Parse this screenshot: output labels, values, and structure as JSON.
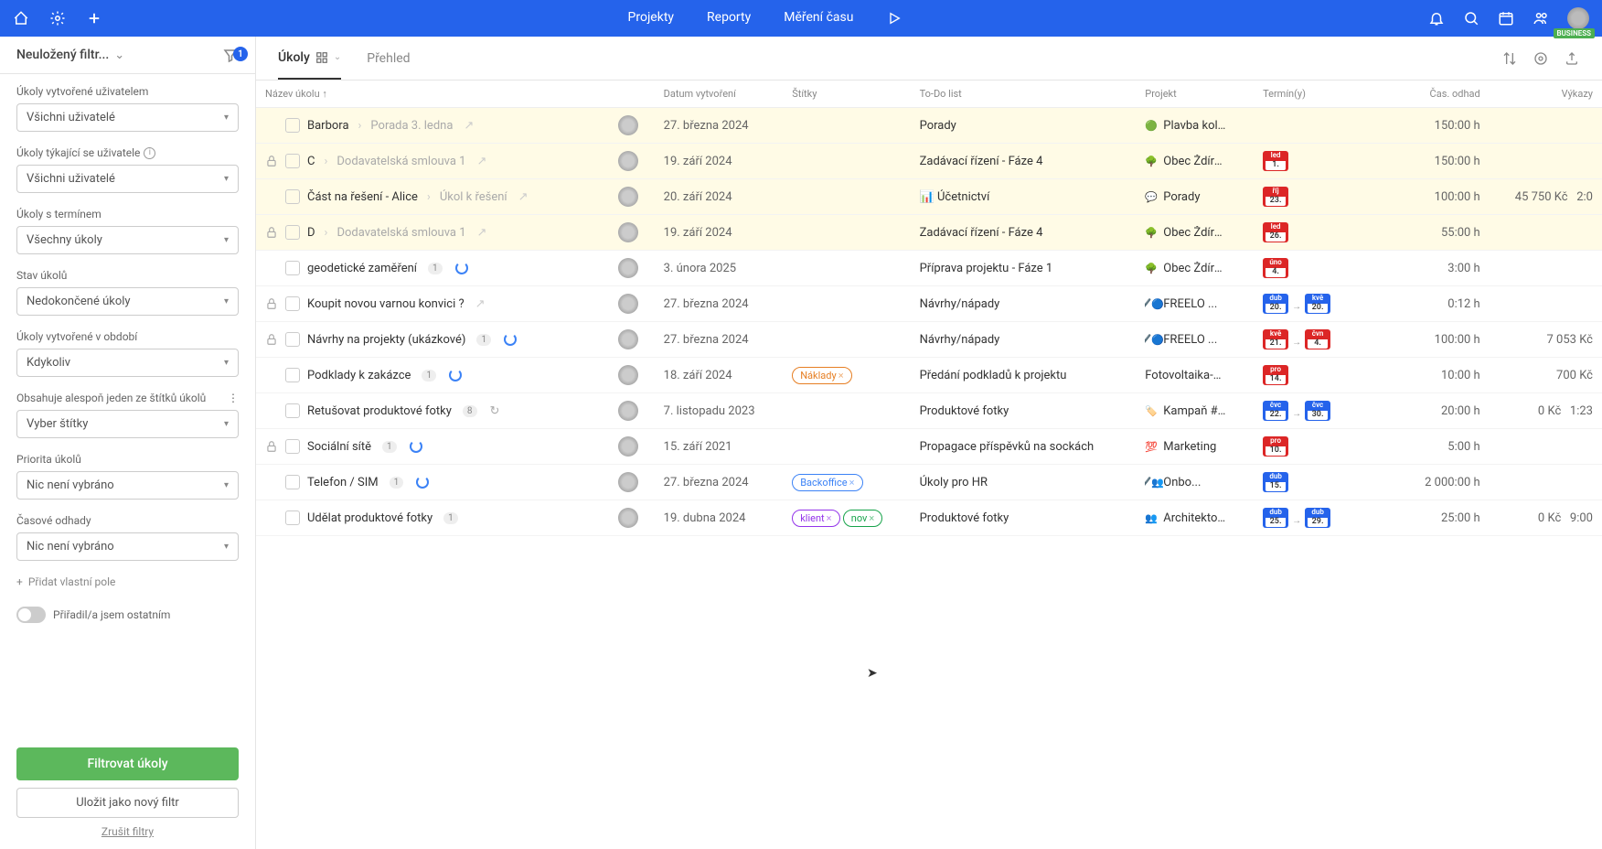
{
  "topbar": {
    "links": [
      "Projekty",
      "Reporty",
      "Měření času"
    ],
    "business": "BUSINESS"
  },
  "sidebar": {
    "filterTitle": "Neuložený filtr...",
    "badge": "1",
    "groups": [
      {
        "label": "Úkoly vytvořené uživatelem",
        "value": "Všichni uživatelé"
      },
      {
        "label": "Úkoly týkající se uživatele",
        "value": "Všichni uživatelé",
        "info": true
      },
      {
        "label": "Úkoly s termínem",
        "value": "Všechny úkoly"
      },
      {
        "label": "Stav úkolů",
        "value": "Nedokončené úkoly"
      },
      {
        "label": "Úkoly vytvořené v období",
        "value": "Kdykoliv"
      },
      {
        "label": "Obsahuje alespoň jeden ze štítků úkolů",
        "value": "Vyber štítky",
        "more": true
      },
      {
        "label": "Priorita úkolů",
        "value": "Nic není vybráno"
      },
      {
        "label": "Časové odhady",
        "value": "Nic není vybráno"
      }
    ],
    "addField": "Přidat vlastní pole",
    "toggleLabel": "Přiřadil/a jsem ostatním",
    "btnFilter": "Filtrovat úkoly",
    "btnSave": "Uložit jako nový filtr",
    "btnCancel": "Zrušit filtry"
  },
  "tabs": {
    "active": "Úkoly",
    "other": "Přehled"
  },
  "columns": [
    "Název úkolu ↑",
    "",
    "Datum vytvoření",
    "Štítky",
    "To-Do list",
    "Projekt",
    "Termín(y)",
    "Čas. odhad",
    "Výkazy"
  ],
  "rows": [
    {
      "hl": true,
      "lock": false,
      "name": "Barbora",
      "sub": "Porada 3. ledna",
      "ext": true,
      "date": "27. března 2024",
      "tags": [],
      "todo": "Porady",
      "projIcon": "🟢",
      "proj": "Plavba kole...",
      "term": [],
      "est": "150:00 h",
      "vyk": ""
    },
    {
      "hl": true,
      "lock": true,
      "name": "C",
      "sub": "Dodavatelská smlouva 1",
      "ext": true,
      "date": "19. září 2024",
      "tags": [],
      "todo": "Zadávací řízení - Fáze 4",
      "projIcon": "🌳",
      "proj": "Obec Ždíre...",
      "term": [
        {
          "c": "red",
          "m": "led",
          "d": "1."
        }
      ],
      "est": "150:00 h",
      "vyk": ""
    },
    {
      "hl": true,
      "lock": false,
      "name": "Část na řešení - Alice",
      "sub": "Úkol k řešení",
      "ext": true,
      "date": "20. září 2024",
      "tags": [],
      "todo": "📊 Účetnictví",
      "projIcon": "💬",
      "proj": "Porady",
      "term": [
        {
          "c": "red",
          "m": "říj",
          "d": "23."
        }
      ],
      "est": "100:00 h",
      "vyk": "45 750 Kč",
      "vyk2": "2:0"
    },
    {
      "hl": true,
      "lock": true,
      "name": "D",
      "sub": "Dodavatelská smlouva 1",
      "ext": true,
      "date": "19. září 2024",
      "tags": [],
      "todo": "Zadávací řízení - Fáze 4",
      "projIcon": "🌳",
      "proj": "Obec Ždíre...",
      "term": [
        {
          "c": "red",
          "m": "led",
          "d": "26."
        }
      ],
      "est": "55:00 h",
      "vyk": ""
    },
    {
      "hl": false,
      "lock": false,
      "name": "geodetické zaměření",
      "badge": "1",
      "spin": true,
      "date": "3. února 2025",
      "tags": [],
      "todo": "Příprava projektu - Fáze 1",
      "projIcon": "🌳",
      "proj": "Obec Ždíre...",
      "term": [
        {
          "c": "red",
          "m": "úno",
          "d": "4."
        }
      ],
      "est": "3:00 h",
      "vyk": ""
    },
    {
      "hl": false,
      "lock": true,
      "name": "Koupit novou varnou konvici ?",
      "ext": true,
      "date": "27. března 2024",
      "tags": [],
      "todo": "Návrhy/nápady",
      "projIcon": "✔️🔵",
      "proj": "FREELO ...",
      "term": [
        {
          "c": "blue",
          "m": "dub",
          "d": "20."
        },
        {
          "c": "blue",
          "m": "kvě",
          "d": "20."
        }
      ],
      "est": "0:12 h",
      "vyk": ""
    },
    {
      "hl": false,
      "lock": true,
      "name": "Návrhy na projekty (ukázkové)",
      "badge": "1",
      "spin": true,
      "date": "27. března 2024",
      "tags": [],
      "todo": "Návrhy/nápady",
      "projIcon": "✔️🔵",
      "proj": "FREELO ...",
      "term": [
        {
          "c": "red",
          "m": "kvě",
          "d": "21."
        },
        {
          "c": "red",
          "m": "čvn",
          "d": "4."
        }
      ],
      "est": "100:00 h",
      "vyk": "7 053 Kč"
    },
    {
      "hl": false,
      "lock": false,
      "name": "Podklady k zakázce",
      "badge": "1",
      "spin": true,
      "date": "18. září 2024",
      "tags": [
        {
          "t": "Náklady",
          "c": "naklady"
        }
      ],
      "todo": "Předání podkladů k projektu",
      "projIcon": "",
      "proj": "Fotovoltaika-p...",
      "term": [
        {
          "c": "red",
          "m": "pro",
          "d": "14."
        }
      ],
      "est": "10:00 h",
      "vyk": "700 Kč"
    },
    {
      "hl": false,
      "lock": false,
      "name": "Retušovat produktové fotky",
      "badge": "8",
      "refresh": true,
      "date": "7. listopadu 2023",
      "tags": [],
      "todo": "Produktové fotky",
      "projIcon": "🏷️",
      "proj": "Kampaň #H...",
      "term": [
        {
          "c": "blue",
          "m": "čvc",
          "d": "22."
        },
        {
          "c": "blue",
          "m": "čvc",
          "d": "30."
        }
      ],
      "est": "20:00 h",
      "vyk": "0 Kč",
      "vyk2": "1:23"
    },
    {
      "hl": false,
      "lock": true,
      "name": "Sociální sítě",
      "badge": "1",
      "spin": true,
      "date": "15. září 2021",
      "tags": [],
      "todo": "Propagace příspěvků na sockách",
      "projIcon": "💯",
      "proj": "Marketing",
      "term": [
        {
          "c": "red",
          "m": "pro",
          "d": "10."
        }
      ],
      "est": "5:00 h",
      "vyk": ""
    },
    {
      "hl": false,
      "lock": false,
      "name": "Telefon / SIM",
      "badge": "1",
      "spin": true,
      "date": "27. března 2024",
      "tags": [
        {
          "t": "Backoffice",
          "c": "backoffice"
        }
      ],
      "todo": "Úkoly pro HR",
      "projIcon": "✔️👥",
      "proj": "Onbo...",
      "term": [
        {
          "c": "blue",
          "m": "dub",
          "d": "15."
        }
      ],
      "est": "2 000:00 h",
      "vyk": ""
    },
    {
      "hl": false,
      "lock": false,
      "name": "Udělat produktové fotky",
      "badge": "1",
      "date": "19. dubna 2024",
      "tags": [
        {
          "t": "klient",
          "c": "klient"
        },
        {
          "t": "nov",
          "c": "novy"
        }
      ],
      "todo": "Produktové fotky",
      "projIcon": "👥",
      "proj": "Architekton...",
      "term": [
        {
          "c": "blue",
          "m": "dub",
          "d": "25."
        },
        {
          "c": "blue",
          "m": "dub",
          "d": "29."
        }
      ],
      "est": "25:00 h",
      "vyk": "0 Kč",
      "vyk2": "9:00"
    }
  ]
}
